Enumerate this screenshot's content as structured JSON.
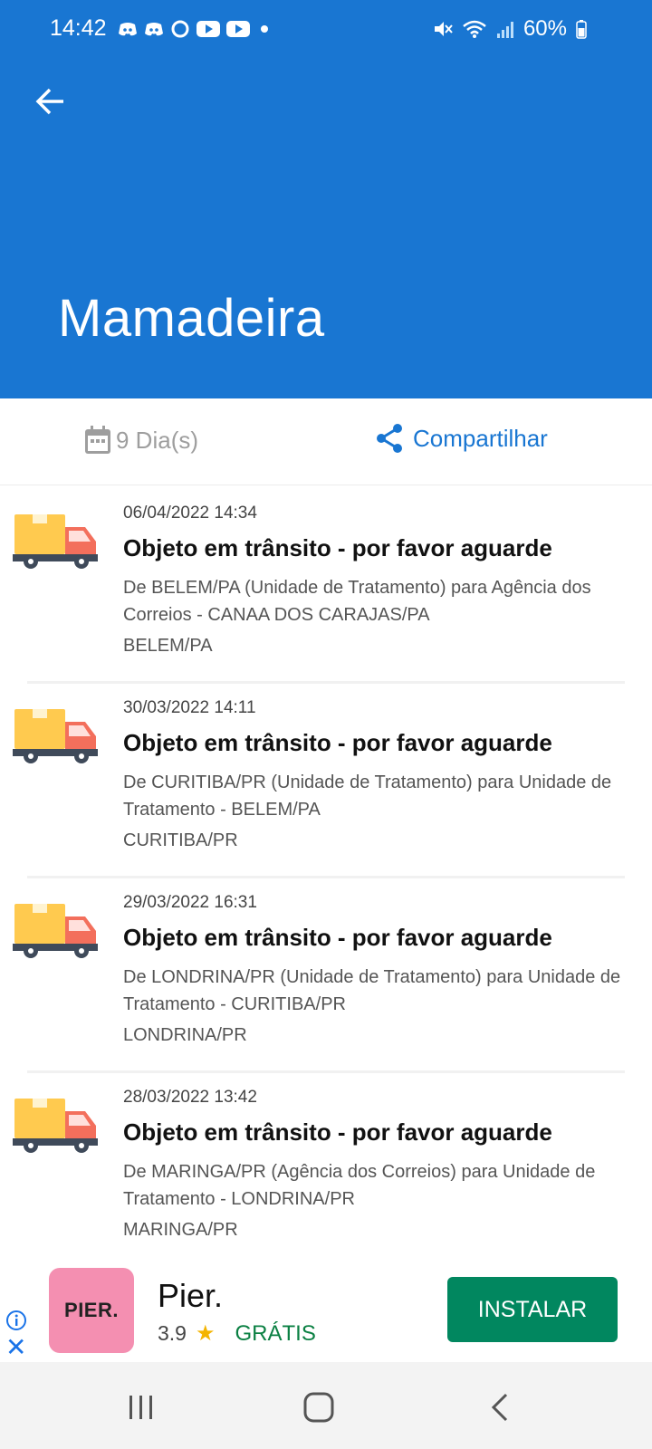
{
  "status_bar": {
    "time": "14:42",
    "battery": "60%",
    "left_icons": [
      "discord-icon",
      "discord-icon",
      "circle-app-icon",
      "youtube-icon",
      "youtube-icon",
      "dot-icon"
    ],
    "right_icons": [
      "mute-icon",
      "wifi-icon",
      "signal-icon",
      "battery-icon"
    ]
  },
  "header": {
    "title": "Mamadeira",
    "color": "#1976d2"
  },
  "summary": {
    "days": "9 Dia(s)",
    "share_label": "Compartilhar"
  },
  "events": [
    {
      "date": "06/04/2022 14:34",
      "title": "Objeto em trânsito - por favor aguarde",
      "description": "De BELEM/PA (Unidade de Tratamento) para Agência dos Correios - CANAA DOS CARAJAS/PA",
      "location": "BELEM/PA"
    },
    {
      "date": "30/03/2022 14:11",
      "title": "Objeto em trânsito - por favor aguarde",
      "description": "De CURITIBA/PR (Unidade de Tratamento) para Unidade de Tratamento - BELEM/PA",
      "location": "CURITIBA/PR"
    },
    {
      "date": "29/03/2022 16:31",
      "title": "Objeto em trânsito - por favor aguarde",
      "description": "De LONDRINA/PR (Unidade de Tratamento) para Unidade de Tratamento - CURITIBA/PR",
      "location": "LONDRINA/PR"
    },
    {
      "date": "28/03/2022 13:42",
      "title": "Objeto em trânsito - por favor aguarde",
      "description": "De MARINGA/PR (Agência dos Correios) para Unidade de Tratamento - LONDRINA/PR",
      "location": "MARINGA/PR"
    }
  ],
  "ad": {
    "logo_text": "PIER.",
    "app_name": "Pier.",
    "rating": "3.9",
    "price": "GRÁTIS",
    "install_label": "INSTALAR"
  },
  "navbar": {
    "buttons": [
      "recents-icon",
      "home-icon",
      "back-nav-icon"
    ]
  }
}
